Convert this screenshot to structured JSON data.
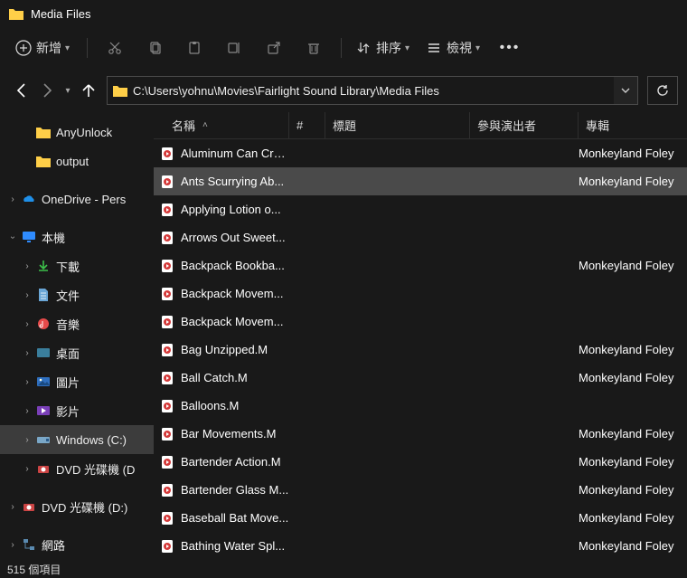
{
  "window": {
    "title": "Media Files"
  },
  "toolbar": {
    "new_label": "新增",
    "sort_label": "排序",
    "view_label": "檢視"
  },
  "address": {
    "path": "C:\\Users\\yohnu\\Movies\\Fairlight Sound Library\\Media Files"
  },
  "sidebar": {
    "anyunlock": "AnyUnlock",
    "output": "output",
    "onedrive": "OneDrive - Pers",
    "thispc": "本機",
    "downloads": "下載",
    "documents": "文件",
    "music": "音樂",
    "desktop": "桌面",
    "pictures": "圖片",
    "videos": "影片",
    "windows_c": "Windows (C:)",
    "dvd_d_1": "DVD 光碟機 (D",
    "dvd_d_2": "DVD 光碟機 (D:)",
    "network": "網路"
  },
  "columns": {
    "name": "名稱",
    "num": "#",
    "title": "標題",
    "artist": "參與演出者",
    "album": "專輯"
  },
  "files": [
    {
      "name": "Aluminum Can Cru...",
      "album": "Monkeyland Foley",
      "selected": false
    },
    {
      "name": "Ants Scurrying Ab...",
      "album": "Monkeyland Foley",
      "selected": true
    },
    {
      "name": "Applying Lotion o...",
      "album": "",
      "selected": false
    },
    {
      "name": "Arrows Out Sweet...",
      "album": "",
      "selected": false
    },
    {
      "name": "Backpack Bookba...",
      "album": "Monkeyland Foley",
      "selected": false
    },
    {
      "name": "Backpack Movem...",
      "album": "",
      "selected": false
    },
    {
      "name": "Backpack Movem...",
      "album": "",
      "selected": false
    },
    {
      "name": "Bag Unzipped.M",
      "album": "Monkeyland Foley",
      "selected": false
    },
    {
      "name": "Ball Catch.M",
      "album": "Monkeyland Foley",
      "selected": false
    },
    {
      "name": "Balloons.M",
      "album": "",
      "selected": false
    },
    {
      "name": "Bar Movements.M",
      "album": "Monkeyland Foley",
      "selected": false
    },
    {
      "name": "Bartender Action.M",
      "album": "Monkeyland Foley",
      "selected": false
    },
    {
      "name": "Bartender Glass M...",
      "album": "Monkeyland Foley",
      "selected": false
    },
    {
      "name": "Baseball Bat Move...",
      "album": "Monkeyland Foley",
      "selected": false
    },
    {
      "name": "Bathing Water Spl...",
      "album": "Monkeyland Foley",
      "selected": false
    }
  ],
  "status": {
    "text": "515 個項目"
  }
}
